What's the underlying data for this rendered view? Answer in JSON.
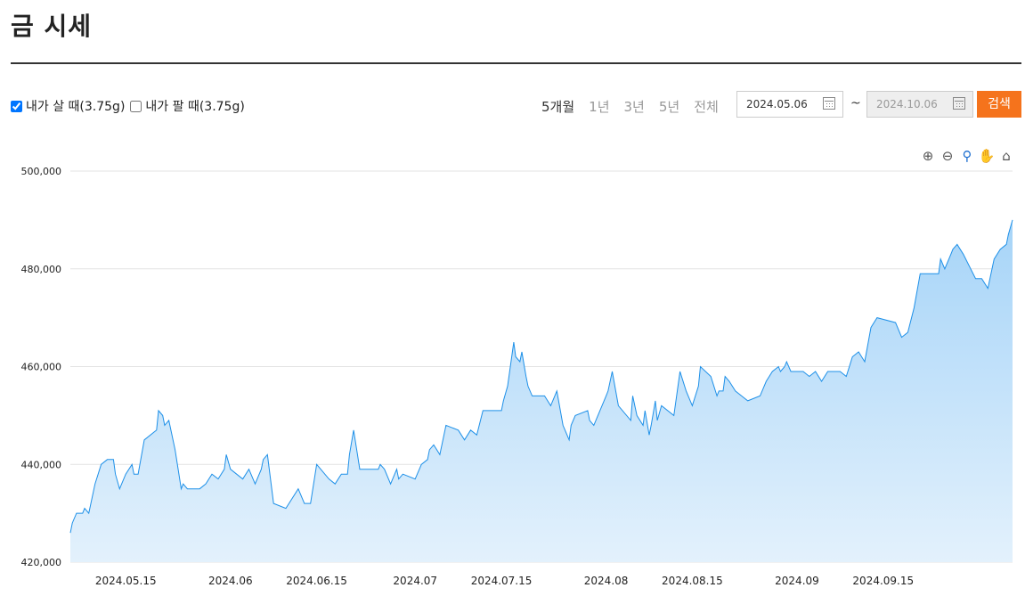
{
  "title": "금 시세",
  "checkboxes": [
    {
      "label": "내가 살 때(3.75g)",
      "checked": true
    },
    {
      "label": "내가 팔 때(3.75g)",
      "checked": false
    }
  ],
  "periods": [
    "5개월",
    "1년",
    "3년",
    "5년",
    "전체"
  ],
  "active_period": "5개월",
  "date_start": "2024.05.06",
  "date_separator": "~",
  "date_end": "2024.10.06",
  "search_label": "검색",
  "toolbar_icons": [
    "zoom-in-icon",
    "zoom-out-icon",
    "magnify-zoom-icon",
    "pan-hand-icon",
    "home-reset-icon"
  ],
  "colors": {
    "accent": "#f5731c",
    "line": "#1e90e8",
    "fill_top": "#a6d4f8",
    "fill_bottom": "#e3f1fc"
  },
  "chart_data": {
    "type": "area",
    "ylim": [
      420000,
      500000
    ],
    "yticks": [
      "420,000",
      "440,000",
      "460,000",
      "480,000",
      "500,000"
    ],
    "yticks_values": [
      420000,
      440000,
      460000,
      480000,
      500000
    ],
    "xlim": [
      "2024-05-06",
      "2024-10-06"
    ],
    "xticks": [
      {
        "date": "2024-05-15",
        "label": "2024.05.15"
      },
      {
        "date": "2024-06-01",
        "label": "2024.06"
      },
      {
        "date": "2024-06-15",
        "label": "2024.06.15"
      },
      {
        "date": "2024-07-01",
        "label": "2024.07"
      },
      {
        "date": "2024-07-15",
        "label": "2024.07.15"
      },
      {
        "date": "2024-08-01",
        "label": "2024.08"
      },
      {
        "date": "2024-08-15",
        "label": "2024.08.15"
      },
      {
        "date": "2024-09-01",
        "label": "2024.09"
      },
      {
        "date": "2024-09-15",
        "label": "2024.09.15"
      }
    ],
    "grid": true,
    "series": [
      {
        "values": [
          [
            "2024-05-06",
            426000
          ],
          [
            "2024-05-06",
            428000
          ],
          [
            "2024-05-07",
            430000
          ],
          [
            "2024-05-08",
            430000
          ],
          [
            "2024-05-08",
            431000
          ],
          [
            "2024-05-09",
            430000
          ],
          [
            "2024-05-10",
            436000
          ],
          [
            "2024-05-11",
            440000
          ],
          [
            "2024-05-12",
            441000
          ],
          [
            "2024-05-13",
            441000
          ],
          [
            "2024-05-13",
            438000
          ],
          [
            "2024-05-14",
            435000
          ],
          [
            "2024-05-15",
            438000
          ],
          [
            "2024-05-16",
            440000
          ],
          [
            "2024-05-16",
            438000
          ],
          [
            "2024-05-17",
            438000
          ],
          [
            "2024-05-18",
            445000
          ],
          [
            "2024-05-20",
            447000
          ],
          [
            "2024-05-20",
            451000
          ],
          [
            "2024-05-21",
            450000
          ],
          [
            "2024-05-21",
            448000
          ],
          [
            "2024-05-22",
            449000
          ],
          [
            "2024-05-23",
            443000
          ],
          [
            "2024-05-24",
            435000
          ],
          [
            "2024-05-24",
            436000
          ],
          [
            "2024-05-25",
            435000
          ],
          [
            "2024-05-27",
            435000
          ],
          [
            "2024-05-28",
            436000
          ],
          [
            "2024-05-29",
            438000
          ],
          [
            "2024-05-30",
            437000
          ],
          [
            "2024-05-31",
            439000
          ],
          [
            "2024-05-31",
            442000
          ],
          [
            "2024-06-01",
            439000
          ],
          [
            "2024-06-03",
            437000
          ],
          [
            "2024-06-04",
            439000
          ],
          [
            "2024-06-05",
            436000
          ],
          [
            "2024-06-06",
            439000
          ],
          [
            "2024-06-06",
            441000
          ],
          [
            "2024-06-07",
            442000
          ],
          [
            "2024-06-08",
            432000
          ],
          [
            "2024-06-10",
            431000
          ],
          [
            "2024-06-12",
            435000
          ],
          [
            "2024-06-13",
            432000
          ],
          [
            "2024-06-14",
            432000
          ],
          [
            "2024-06-15",
            440000
          ],
          [
            "2024-06-17",
            437000
          ],
          [
            "2024-06-18",
            436000
          ],
          [
            "2024-06-19",
            438000
          ],
          [
            "2024-06-20",
            438000
          ],
          [
            "2024-06-20",
            442000
          ],
          [
            "2024-06-21",
            447000
          ],
          [
            "2024-06-22",
            439000
          ],
          [
            "2024-06-25",
            439000
          ],
          [
            "2024-06-25",
            440000
          ],
          [
            "2024-06-26",
            439000
          ],
          [
            "2024-06-27",
            436000
          ],
          [
            "2024-06-28",
            439000
          ],
          [
            "2024-06-28",
            437000
          ],
          [
            "2024-06-29",
            438000
          ],
          [
            "2024-07-01",
            437000
          ],
          [
            "2024-07-02",
            440000
          ],
          [
            "2024-07-03",
            441000
          ],
          [
            "2024-07-03",
            443000
          ],
          [
            "2024-07-04",
            444000
          ],
          [
            "2024-07-05",
            442000
          ],
          [
            "2024-07-06",
            448000
          ],
          [
            "2024-07-08",
            447000
          ],
          [
            "2024-07-09",
            445000
          ],
          [
            "2024-07-10",
            447000
          ],
          [
            "2024-07-11",
            446000
          ],
          [
            "2024-07-12",
            451000
          ],
          [
            "2024-07-14",
            451000
          ],
          [
            "2024-07-15",
            451000
          ],
          [
            "2024-07-15",
            453000
          ],
          [
            "2024-07-16",
            456000
          ],
          [
            "2024-07-17",
            465000
          ],
          [
            "2024-07-17",
            462000
          ],
          [
            "2024-07-18",
            461000
          ],
          [
            "2024-07-18",
            463000
          ],
          [
            "2024-07-19",
            458000
          ],
          [
            "2024-07-19",
            456000
          ],
          [
            "2024-07-20",
            454000
          ],
          [
            "2024-07-22",
            454000
          ],
          [
            "2024-07-23",
            452000
          ],
          [
            "2024-07-24",
            455000
          ],
          [
            "2024-07-25",
            448000
          ],
          [
            "2024-07-26",
            445000
          ],
          [
            "2024-07-26",
            448000
          ],
          [
            "2024-07-27",
            450000
          ],
          [
            "2024-07-29",
            451000
          ],
          [
            "2024-07-29",
            449000
          ],
          [
            "2024-07-30",
            448000
          ],
          [
            "2024-07-31",
            451000
          ],
          [
            "2024-08-01",
            454000
          ],
          [
            "2024-08-01",
            455000
          ],
          [
            "2024-08-02",
            459000
          ],
          [
            "2024-08-03",
            452000
          ],
          [
            "2024-08-05",
            449000
          ],
          [
            "2024-08-05",
            454000
          ],
          [
            "2024-08-06",
            450000
          ],
          [
            "2024-08-07",
            448000
          ],
          [
            "2024-08-07",
            451000
          ],
          [
            "2024-08-08",
            446000
          ],
          [
            "2024-08-08",
            448000
          ],
          [
            "2024-08-09",
            453000
          ],
          [
            "2024-08-09",
            449000
          ],
          [
            "2024-08-10",
            452000
          ],
          [
            "2024-08-12",
            450000
          ],
          [
            "2024-08-13",
            459000
          ],
          [
            "2024-08-14",
            455000
          ],
          [
            "2024-08-15",
            452000
          ],
          [
            "2024-08-16",
            456000
          ],
          [
            "2024-08-16",
            460000
          ],
          [
            "2024-08-18",
            458000
          ],
          [
            "2024-08-19",
            454000
          ],
          [
            "2024-08-19",
            455000
          ],
          [
            "2024-08-20",
            455000
          ],
          [
            "2024-08-20",
            458000
          ],
          [
            "2024-08-21",
            457000
          ],
          [
            "2024-08-22",
            455000
          ],
          [
            "2024-08-23",
            454000
          ],
          [
            "2024-08-24",
            453000
          ],
          [
            "2024-08-26",
            454000
          ],
          [
            "2024-08-27",
            457000
          ],
          [
            "2024-08-28",
            459000
          ],
          [
            "2024-08-29",
            460000
          ],
          [
            "2024-08-29",
            459000
          ],
          [
            "2024-08-30",
            460000
          ],
          [
            "2024-08-30",
            461000
          ],
          [
            "2024-08-31",
            459000
          ],
          [
            "2024-09-02",
            459000
          ],
          [
            "2024-09-03",
            458000
          ],
          [
            "2024-09-04",
            459000
          ],
          [
            "2024-09-05",
            457000
          ],
          [
            "2024-09-06",
            459000
          ],
          [
            "2024-09-08",
            459000
          ],
          [
            "2024-09-09",
            458000
          ],
          [
            "2024-09-10",
            462000
          ],
          [
            "2024-09-11",
            463000
          ],
          [
            "2024-09-12",
            461000
          ],
          [
            "2024-09-13",
            468000
          ],
          [
            "2024-09-14",
            470000
          ],
          [
            "2024-09-17",
            469000
          ],
          [
            "2024-09-18",
            466000
          ],
          [
            "2024-09-19",
            467000
          ],
          [
            "2024-09-20",
            472000
          ],
          [
            "2024-09-21",
            479000
          ],
          [
            "2024-09-24",
            479000
          ],
          [
            "2024-09-24",
            482000
          ],
          [
            "2024-09-25",
            480000
          ],
          [
            "2024-09-26",
            483000
          ],
          [
            "2024-09-26",
            484000
          ],
          [
            "2024-09-27",
            485000
          ],
          [
            "2024-09-28",
            483000
          ],
          [
            "2024-09-30",
            478000
          ],
          [
            "2024-10-01",
            478000
          ],
          [
            "2024-10-02",
            476000
          ],
          [
            "2024-10-03",
            482000
          ],
          [
            "2024-10-04",
            484000
          ],
          [
            "2024-10-05",
            485000
          ],
          [
            "2024-10-05",
            487000
          ],
          [
            "2024-10-06",
            490000
          ]
        ]
      }
    ]
  }
}
